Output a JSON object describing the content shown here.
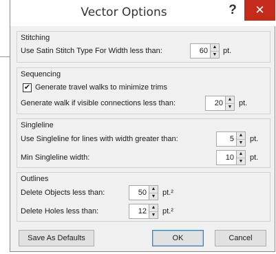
{
  "window": {
    "title": "Vector Options",
    "help_label": "?",
    "close_label": "✕"
  },
  "stitching": {
    "title": "Stitching",
    "satin_label": "Use Satin Stitch Type For Width less than:",
    "satin_value": "60",
    "satin_unit": "pt."
  },
  "sequencing": {
    "title": "Sequencing",
    "travel_label": "Generate travel walks to minimize trims",
    "travel_checked": true,
    "walk_label": "Generate walk if visible connections less than:",
    "walk_value": "20",
    "walk_unit": "pt."
  },
  "singleline": {
    "title": "Singleline",
    "use_label": "Use Singleline for lines with width greater than:",
    "use_value": "5",
    "use_unit": "pt.",
    "min_label": "Min Singleline width:",
    "min_value": "10",
    "min_unit": "pt."
  },
  "outlines": {
    "title": "Outlines",
    "objects_label": "Delete Objects less than:",
    "objects_value": "50",
    "objects_unit": "pt.²",
    "holes_label": "Delete Holes less than:",
    "holes_value": "12",
    "holes_unit": "pt.²"
  },
  "buttons": {
    "defaults_label": "Save As Defaults",
    "ok_label": "OK",
    "cancel_label": "Cancel"
  },
  "icons": {
    "spin_up": "▲",
    "spin_down": "▼",
    "check": "✔"
  },
  "colors": {
    "close_bg": "#c42b1c",
    "window_bg": "#f0f0f0",
    "accent": "#3c7fb1"
  }
}
